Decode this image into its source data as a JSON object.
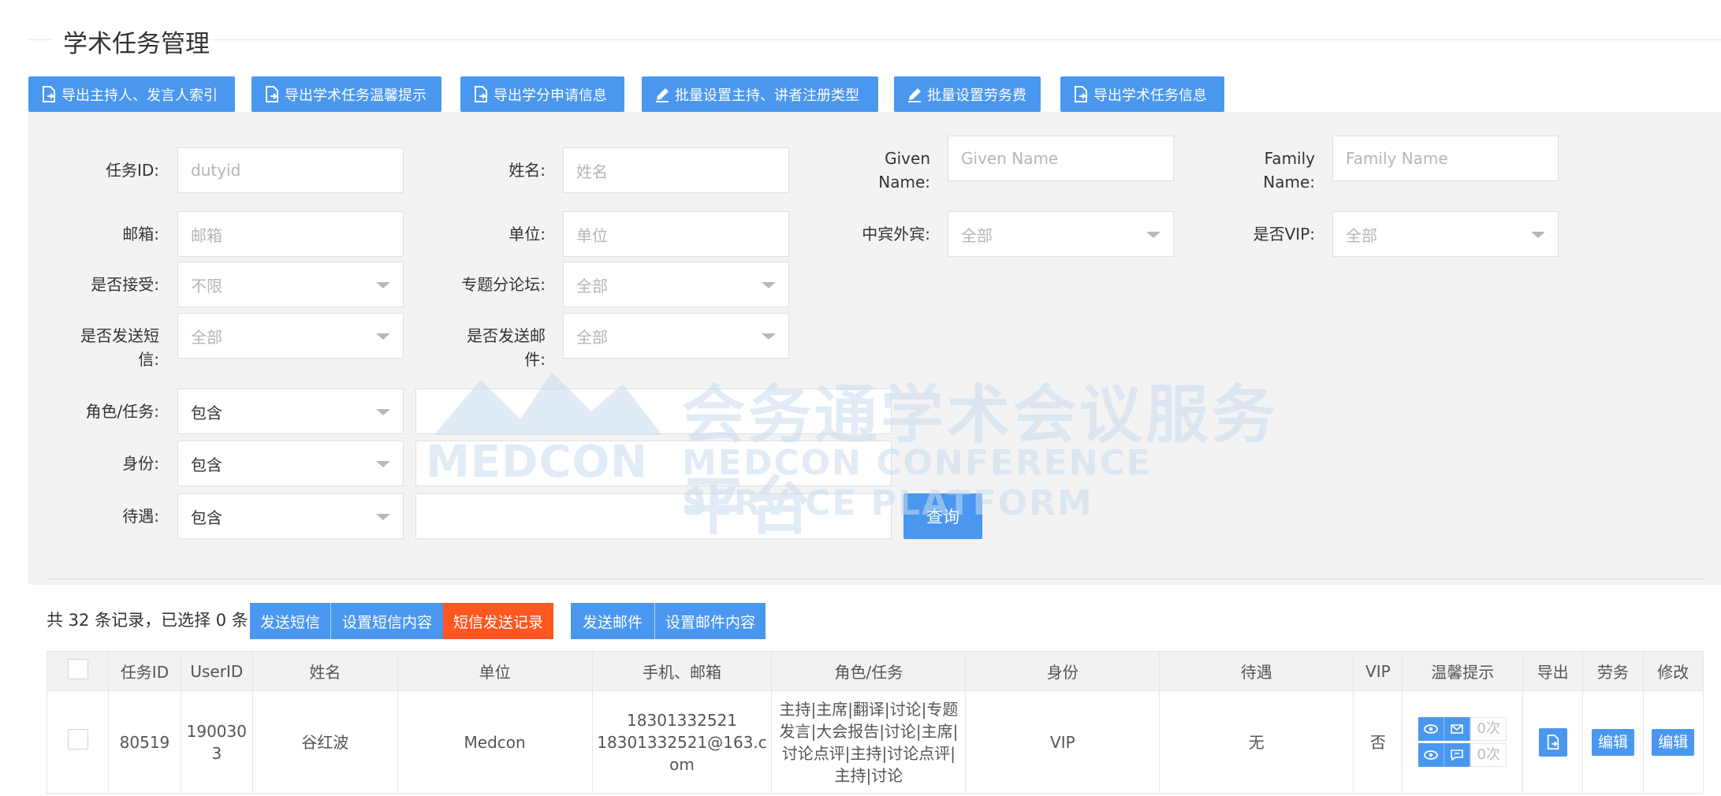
{
  "page": {
    "title": "学术任务管理"
  },
  "toolbar": {
    "buttons": [
      {
        "label": "导出主持人、发言人索引",
        "icon": "export-file-icon"
      },
      {
        "label": "导出学术任务温馨提示",
        "icon": "export-file-icon"
      },
      {
        "label": "导出学分申请信息",
        "icon": "export-file-icon"
      },
      {
        "label": "批量设置主持、讲者注册类型",
        "icon": "edit-pencil-icon"
      },
      {
        "label": "批量设置劳务费",
        "icon": "edit-pencil-icon"
      },
      {
        "label": "导出学术任务信息",
        "icon": "export-file-icon"
      }
    ]
  },
  "filters": {
    "duty_id": {
      "label": "任务ID:",
      "placeholder": "dutyid"
    },
    "name": {
      "label": "姓名:",
      "placeholder": "姓名"
    },
    "given_name": {
      "label_1": "Given",
      "label_2": "Name:",
      "placeholder": "Given Name"
    },
    "family_name": {
      "label_1": "Family",
      "label_2": "Name:",
      "placeholder": "Family Name"
    },
    "email": {
      "label": "邮箱:",
      "placeholder": "邮箱"
    },
    "unit": {
      "label": "单位:",
      "placeholder": "单位"
    },
    "guest_type": {
      "label": "中宾外宾:",
      "value": "全部"
    },
    "is_vip": {
      "label": "是否VIP:",
      "value": "全部"
    },
    "accepted": {
      "label": "是否接受:",
      "value": "不限"
    },
    "forum": {
      "label": "专题分论坛:",
      "value": "全部"
    },
    "sms_sent": {
      "label_1": "是否发送短",
      "label_2": "信:",
      "value": "全部"
    },
    "mail_sent": {
      "label_1": "是否发送邮",
      "label_2": "件:",
      "value": "全部"
    },
    "role": {
      "label": "角色/任务:",
      "mode": "包含",
      "value": ""
    },
    "identity": {
      "label": "身份:",
      "mode": "包含",
      "value": ""
    },
    "treatment": {
      "label": "待遇:",
      "mode": "包含",
      "value": ""
    },
    "query_label": "查询"
  },
  "watermark": {
    "logo_text": "MEDCON",
    "cn": "会务通学术会议服务平台",
    "en": "MEDCON CONFERENCE SERVICE PLATFORM"
  },
  "records": {
    "summary": "共 32 条记录，已选择 0 条",
    "send_sms": "发送短信",
    "set_sms": "设置短信内容",
    "sms_log": "短信发送记录",
    "send_mail": "发送邮件",
    "set_mail": "设置邮件内容"
  },
  "table": {
    "headers": [
      "",
      "任务ID",
      "UserID",
      "姓名",
      "单位",
      "手机、邮箱",
      "角色/任务",
      "身份",
      "待遇",
      "VIP",
      "温馨提示",
      "导出",
      "劳务",
      "修改"
    ],
    "rows": [
      {
        "duty_id": "80519",
        "user_id": "1900303",
        "name": "谷红波",
        "unit": "Medcon",
        "phone": "18301332521",
        "email": "18301332521@163.com",
        "role": "主持|主席|翻译|讨论|专题发言|大会报告|讨论|主席|讨论点评|主持|讨论点评|主持|讨论",
        "identity": "VIP",
        "treatment": "无",
        "vip": "否",
        "mail_count": "0次",
        "sms_count": "0次",
        "labor": "编辑",
        "edit": "编辑"
      }
    ]
  },
  "colors": {
    "primary": "#4a97f0",
    "orange": "#ff5722",
    "panel": "#f3f3f3"
  }
}
